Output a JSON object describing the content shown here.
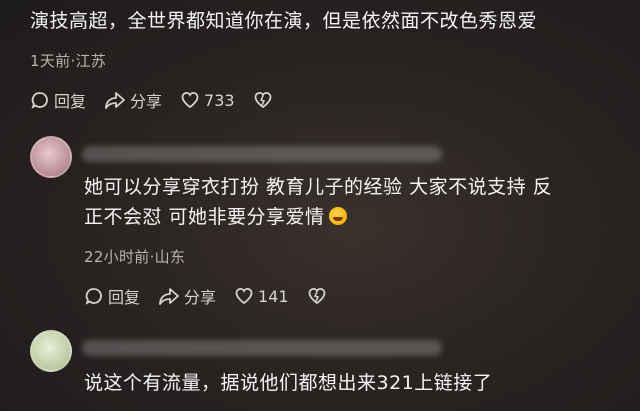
{
  "comments": [
    {
      "text": "演技高超，全世界都知道你在演，但是依然面不改色秀恩爱",
      "meta": "1天前·江苏",
      "reply_label": "回复",
      "share_label": "分享",
      "likes": "733"
    },
    {
      "text_line1": "她可以分享穿衣打扮 教育儿子的经验 大家不说支持 反",
      "text_line2": "正不会怼 可她非要分享爱情",
      "emoji": "crying-laughing-emoji",
      "meta": "22小时前·山东",
      "reply_label": "回复",
      "share_label": "分享",
      "likes": "141"
    },
    {
      "text": "说这个有流量，据说他们都想出来321上链接了"
    }
  ]
}
